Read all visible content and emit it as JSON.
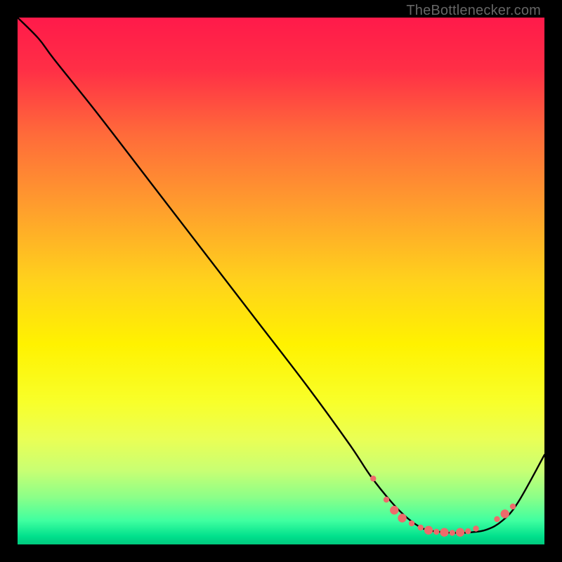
{
  "watermark": "TheBottlenecker.com",
  "chart_data": {
    "type": "line",
    "title": "",
    "xlabel": "",
    "ylabel": "",
    "xlim": [
      0,
      100
    ],
    "ylim": [
      0,
      100
    ],
    "background": {
      "type": "vertical-gradient",
      "stops": [
        {
          "pos": 0.0,
          "color": "#ff1a4a"
        },
        {
          "pos": 0.1,
          "color": "#ff2f46"
        },
        {
          "pos": 0.22,
          "color": "#ff6a3a"
        },
        {
          "pos": 0.35,
          "color": "#ff9a2e"
        },
        {
          "pos": 0.5,
          "color": "#ffd21c"
        },
        {
          "pos": 0.62,
          "color": "#fff200"
        },
        {
          "pos": 0.73,
          "color": "#f8ff2a"
        },
        {
          "pos": 0.8,
          "color": "#eaff55"
        },
        {
          "pos": 0.86,
          "color": "#c8ff73"
        },
        {
          "pos": 0.91,
          "color": "#8cff88"
        },
        {
          "pos": 0.955,
          "color": "#3fffa0"
        },
        {
          "pos": 0.985,
          "color": "#00e08c"
        },
        {
          "pos": 1.0,
          "color": "#00c97d"
        }
      ]
    },
    "series": [
      {
        "name": "bottleneck-curve",
        "color": "#000000",
        "x": [
          0,
          4,
          7,
          15,
          25,
          35,
          45,
          55,
          63,
          67,
          71,
          74,
          77,
          80,
          83,
          86,
          89,
          92,
          95,
          100
        ],
        "y": [
          100,
          96,
          92,
          82,
          69,
          56,
          43,
          30,
          19,
          13,
          8,
          5,
          3,
          2.4,
          2.2,
          2.3,
          2.8,
          4.5,
          8,
          17
        ]
      }
    ],
    "markers": {
      "name": "highlight-dots",
      "color": "#ed6b6b",
      "radius_small": 4.2,
      "radius_large": 6.2,
      "points": [
        {
          "x": 67.5,
          "y": 12.5,
          "r": "small"
        },
        {
          "x": 70.0,
          "y": 8.5,
          "r": "small"
        },
        {
          "x": 71.5,
          "y": 6.5,
          "r": "large"
        },
        {
          "x": 73.0,
          "y": 5.0,
          "r": "large"
        },
        {
          "x": 74.8,
          "y": 4.0,
          "r": "small"
        },
        {
          "x": 76.5,
          "y": 3.2,
          "r": "small"
        },
        {
          "x": 78.0,
          "y": 2.7,
          "r": "large"
        },
        {
          "x": 79.5,
          "y": 2.4,
          "r": "small"
        },
        {
          "x": 81.0,
          "y": 2.3,
          "r": "large"
        },
        {
          "x": 82.5,
          "y": 2.2,
          "r": "small"
        },
        {
          "x": 84.0,
          "y": 2.3,
          "r": "large"
        },
        {
          "x": 85.5,
          "y": 2.5,
          "r": "small"
        },
        {
          "x": 87.0,
          "y": 3.0,
          "r": "small"
        },
        {
          "x": 91.0,
          "y": 4.8,
          "r": "small"
        },
        {
          "x": 92.5,
          "y": 5.8,
          "r": "large"
        },
        {
          "x": 94.0,
          "y": 7.2,
          "r": "small"
        }
      ]
    }
  }
}
